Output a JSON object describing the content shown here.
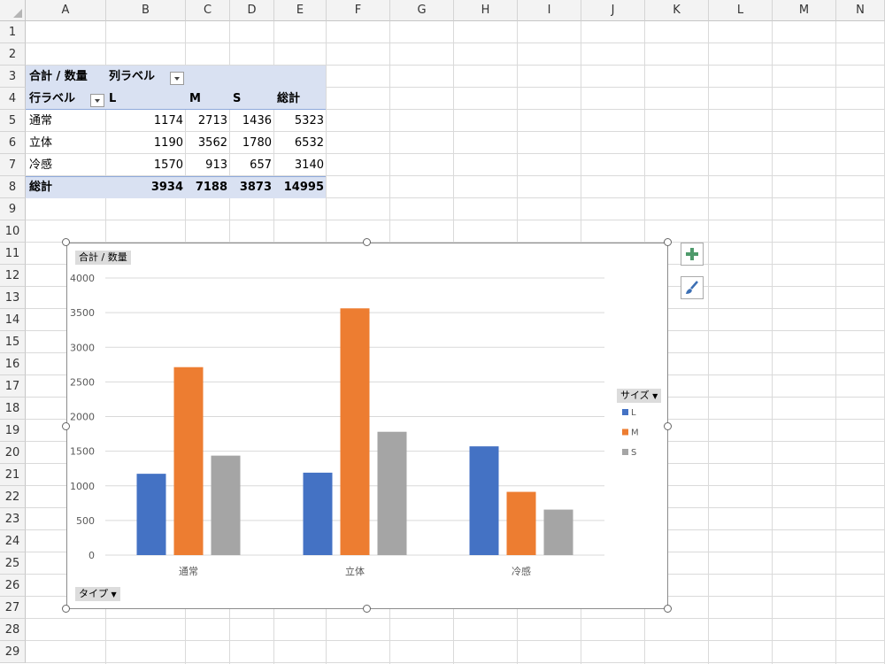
{
  "columns": [
    "A",
    "B",
    "C",
    "D",
    "E",
    "F",
    "G",
    "H",
    "I",
    "J",
    "K",
    "L",
    "M",
    "N"
  ],
  "rows": [
    "1",
    "2",
    "3",
    "4",
    "5",
    "6",
    "7",
    "8",
    "9",
    "10",
    "11",
    "12",
    "13",
    "14",
    "15",
    "16",
    "17",
    "18",
    "19",
    "20",
    "21",
    "22",
    "23",
    "24",
    "25",
    "26",
    "27",
    "28",
    "29"
  ],
  "pivot": {
    "value_label": "合計 / 数量",
    "col_label": "列ラベル",
    "row_label": "行ラベル",
    "col_headers": [
      "L",
      "M",
      "S",
      "総計"
    ],
    "rows": [
      {
        "label": "通常",
        "values": [
          "1174",
          "2713",
          "1436",
          "5323"
        ]
      },
      {
        "label": "立体",
        "values": [
          "1190",
          "3562",
          "1780",
          "6532"
        ]
      },
      {
        "label": "冷感",
        "values": [
          "1570",
          "913",
          "657",
          "3140"
        ]
      }
    ],
    "total": {
      "label": "総計",
      "values": [
        "3934",
        "7188",
        "3873",
        "14995"
      ]
    }
  },
  "chart_ui": {
    "value_field_button": "合計 / 数量",
    "axis_field_button": "タイプ",
    "legend_field_button": "サイズ"
  },
  "chart_data": {
    "type": "bar",
    "categories": [
      "通常",
      "立体",
      "冷感"
    ],
    "series": [
      {
        "name": "L",
        "values": [
          1174,
          1190,
          1570
        ],
        "color": "#4472c4"
      },
      {
        "name": "M",
        "values": [
          2713,
          3562,
          913
        ],
        "color": "#ed7d31"
      },
      {
        "name": "S",
        "values": [
          1436,
          1780,
          657
        ],
        "color": "#a5a5a5"
      }
    ],
    "yticks": [
      "0",
      "500",
      "1000",
      "1500",
      "2000",
      "2500",
      "3000",
      "3500",
      "4000"
    ],
    "ylim": [
      0,
      4000
    ],
    "grid": true,
    "legend_position": "right"
  },
  "colors": {
    "pivot_band": "#d9e1f2",
    "gridline": "#d9d9d9",
    "plus_icon": "#4e9a6b",
    "brush_icon": "#3c6fb4"
  }
}
